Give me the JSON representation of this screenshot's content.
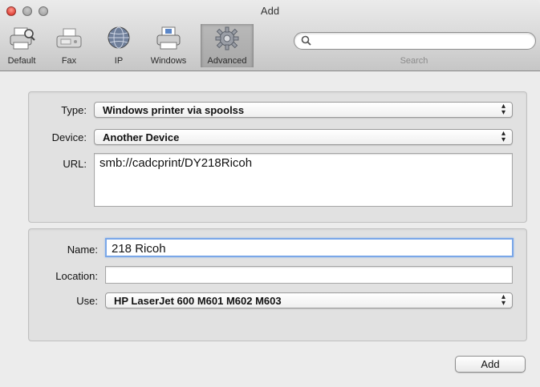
{
  "window": {
    "title": "Add"
  },
  "toolbar": {
    "items": [
      {
        "label": "Default",
        "icon": "default-printer-icon"
      },
      {
        "label": "Fax",
        "icon": "fax-icon"
      },
      {
        "label": "IP",
        "icon": "globe-icon"
      },
      {
        "label": "Windows",
        "icon": "windows-printer-icon"
      },
      {
        "label": "Advanced",
        "icon": "gear-icon"
      }
    ],
    "selected": "Advanced"
  },
  "search": {
    "label": "Search",
    "value": ""
  },
  "connection": {
    "type_label": "Type:",
    "type_value": "Windows printer via spoolss",
    "device_label": "Device:",
    "device_value": "Another Device",
    "url_label": "URL:",
    "url_value": "smb://cadcprint/DY218Ricoh"
  },
  "details": {
    "name_label": "Name:",
    "name_value": "218 Ricoh",
    "location_label": "Location:",
    "location_value": "",
    "use_label": "Use:",
    "use_value": "HP LaserJet 600 M601 M602 M603"
  },
  "actions": {
    "add_label": "Add"
  },
  "colors": {
    "focus_ring": "#7aa7e8",
    "close_button": "#e0443a"
  }
}
